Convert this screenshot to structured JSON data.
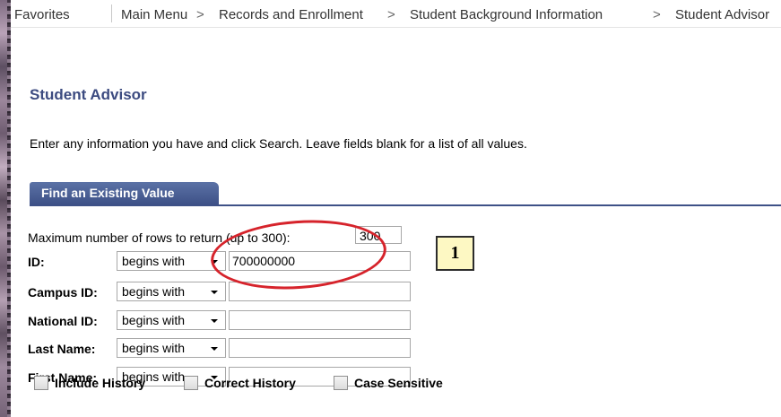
{
  "nav": {
    "items": [
      "Favorites",
      "Main Menu",
      "Records and Enrollment",
      "Student Background Information",
      "Student Advisor"
    ],
    "separator": ">"
  },
  "page": {
    "title": "Student Advisor",
    "instructions": "Enter any information you have and click Search. Leave fields blank for a list of all values."
  },
  "tab": {
    "label": "Find an Existing Value"
  },
  "form": {
    "max_rows_label": "Maximum number of rows to return (up to 300):",
    "max_rows_value": "300",
    "fields": [
      {
        "label": "ID:",
        "operator": "begins with",
        "value": "700000000"
      },
      {
        "label": "Campus ID:",
        "operator": "begins with",
        "value": ""
      },
      {
        "label": "National ID:",
        "operator": "begins with",
        "value": ""
      },
      {
        "label": "Last Name:",
        "operator": "begins with",
        "value": ""
      },
      {
        "label": "First Name:",
        "operator": "begins with",
        "value": ""
      }
    ],
    "checkboxes": [
      {
        "label": "Include History",
        "checked": false
      },
      {
        "label": "Correct History",
        "checked": false
      },
      {
        "label": "Case Sensitive",
        "checked": false
      }
    ]
  },
  "annotation": {
    "callout_number": "1",
    "highlight_color": "#d6232b"
  }
}
